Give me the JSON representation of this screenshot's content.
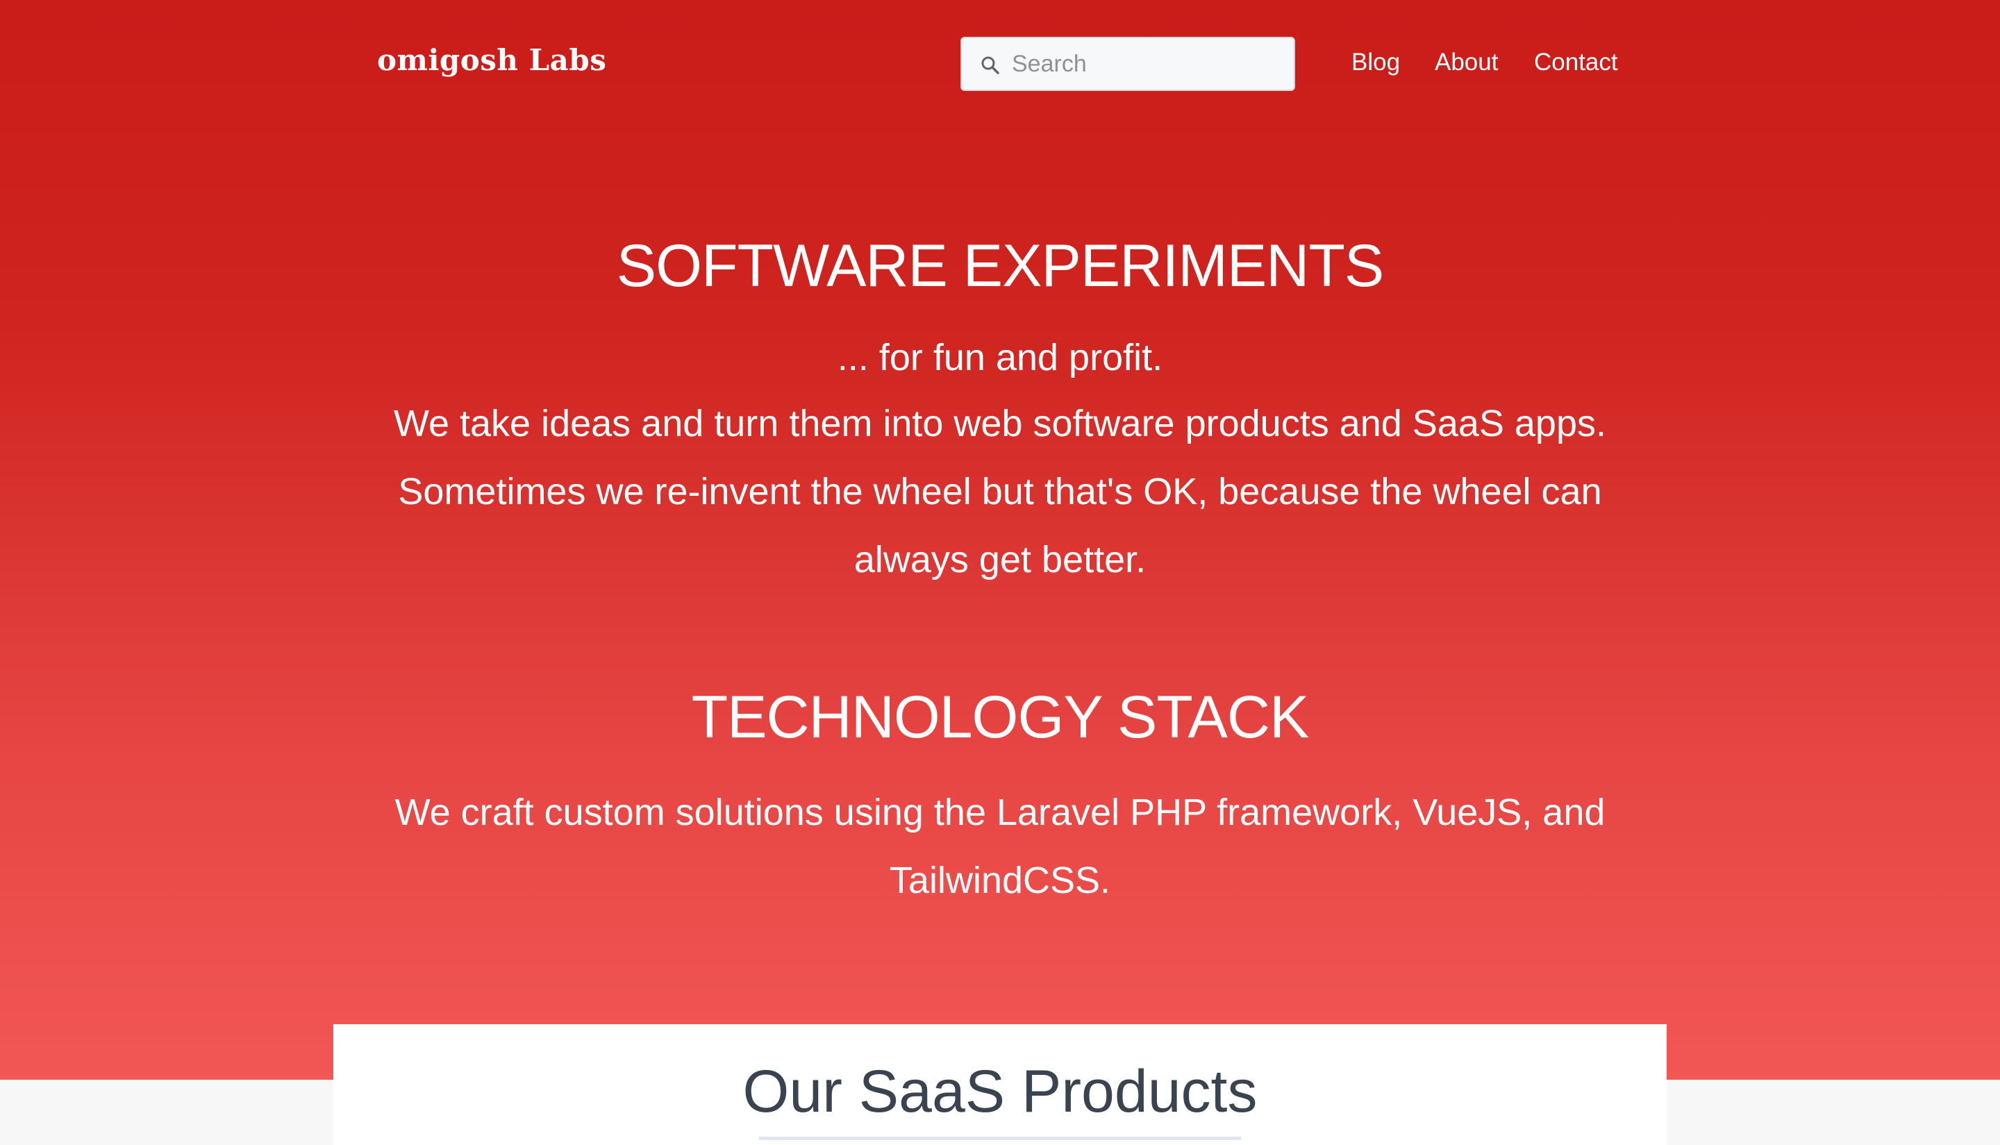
{
  "header": {
    "brand": "omigosh Labs",
    "search": {
      "placeholder": "Search",
      "icon": "search-icon"
    },
    "nav": [
      {
        "label": "Blog"
      },
      {
        "label": "About"
      },
      {
        "label": "Contact"
      }
    ]
  },
  "hero": {
    "experiments": {
      "title": "SOFTWARE EXPERIMENTS",
      "tagline": "... for fun and profit.",
      "body": "We take ideas and turn them into web software products and SaaS apps. Sometimes we re-invent the wheel but that's OK, because the wheel can always get better."
    },
    "stack": {
      "title": "TECHNOLOGY STACK",
      "body": "We craft custom solutions using the Laravel PHP framework, VueJS, and TailwindCSS."
    }
  },
  "products": {
    "title": "Our SaaS Products"
  },
  "colors": {
    "hero_top": "#ca1c19",
    "hero_bottom": "#f25755",
    "text_light": "#ffffff",
    "products_title": "#3a4350"
  }
}
